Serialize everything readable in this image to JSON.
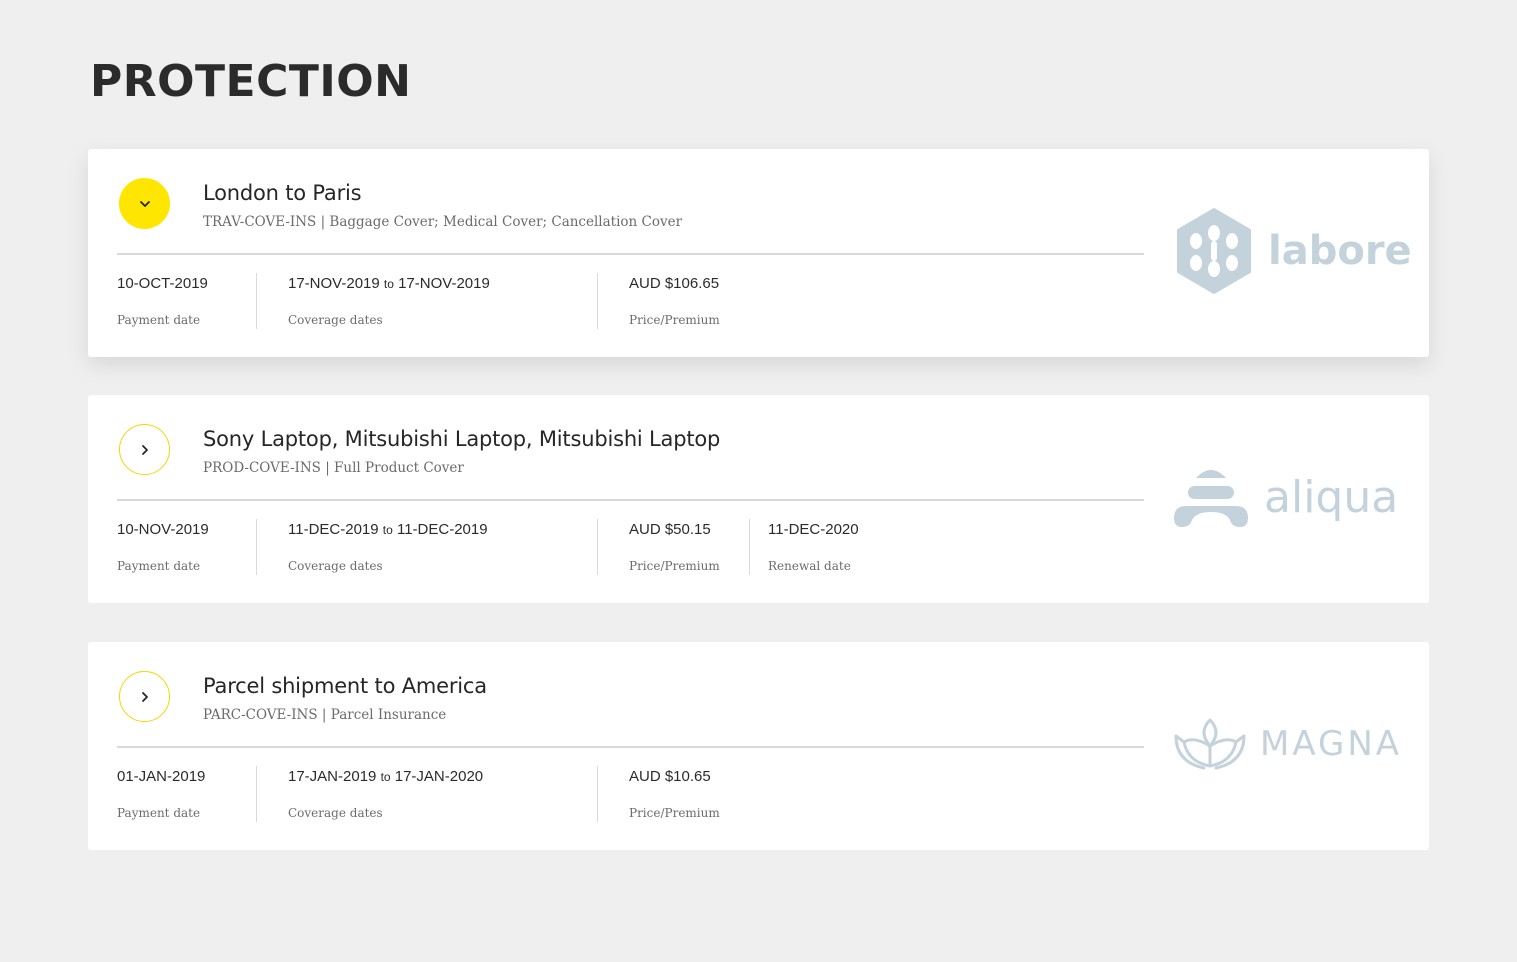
{
  "page": {
    "title": "PROTECTION"
  },
  "colors": {
    "accent": "#ffe600",
    "logo": "#c4d2dc",
    "background": "#efefef"
  },
  "policies": [
    {
      "expanded": true,
      "toggle_icon": "chevron-down-icon",
      "title": "London to Paris",
      "subtitle": "TRAV-COVE-INS | Baggage Cover; Medical Cover; Cancellation Cover",
      "payment_date": "10-OCT-2019",
      "payment_label": "Payment date",
      "coverage_start": "17-NOV-2019",
      "coverage_to": "to",
      "coverage_end": "17-NOV-2019",
      "coverage_label": "Coverage dates",
      "price": "AUD $106.65",
      "price_label": "Price/Premium",
      "logo_name": "labore",
      "logo_icon": "hexagon-logo-icon"
    },
    {
      "expanded": false,
      "toggle_icon": "chevron-right-icon",
      "title": "Sony Laptop, Mitsubishi Laptop, Mitsubishi Laptop",
      "subtitle": "PROD-COVE-INS | Full Product Cover",
      "payment_date": "10-NOV-2019",
      "payment_label": "Payment date",
      "coverage_start": "11-DEC-2019",
      "coverage_to": "to",
      "coverage_end": "11-DEC-2019",
      "coverage_label": "Coverage dates",
      "price": "AUD $50.15",
      "price_label": "Price/Premium",
      "renewal_date": "11-DEC-2020",
      "renewal_label": "Renewal date",
      "logo_name": "aliqua",
      "logo_icon": "arch-logo-icon"
    },
    {
      "expanded": false,
      "toggle_icon": "chevron-right-icon",
      "title": "Parcel shipment to America",
      "subtitle": "PARC-COVE-INS | Parcel Insurance",
      "payment_date": "01-JAN-2019",
      "payment_label": "Payment date",
      "coverage_start": "17-JAN-2019",
      "coverage_to": "to",
      "coverage_end": "17-JAN-2020",
      "coverage_label": "Coverage dates",
      "price": "AUD $10.65",
      "price_label": "Price/Premium",
      "logo_name": "MAGNA",
      "logo_icon": "lotus-logo-icon"
    }
  ]
}
